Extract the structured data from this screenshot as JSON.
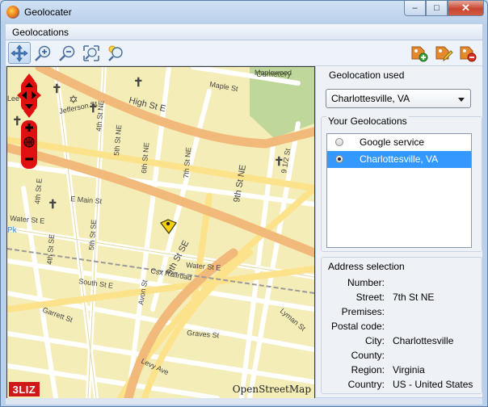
{
  "window": {
    "title": "Geolocater",
    "controls": {
      "minimize": "–",
      "maximize": "□",
      "close": "✕"
    }
  },
  "menubar": {
    "items": [
      "Geolocations"
    ]
  },
  "toolbar": {
    "left_tools": [
      "pan-icon",
      "zoom-in-icon",
      "zoom-out-icon",
      "zoom-extent-icon",
      "zoom-location-icon"
    ],
    "right_tools": [
      "add-location-icon",
      "edit-location-icon",
      "remove-location-icon"
    ],
    "active_tool": "pan-icon"
  },
  "map": {
    "attribution": "OpenStreetMap",
    "brand": "3LIZ",
    "labels": {
      "cemetery1": "Maplewood",
      "cemetery2": "Cemetery",
      "maple": "Maple St",
      "high": "High St E",
      "jefferson": "Jefferson St",
      "fourth_ne": "4th St NE",
      "fifth_ne": "5th St NE",
      "sixth_ne": "6th St NE",
      "seventh_ne": "7th St NE",
      "ninth_ne": "9th St NE",
      "nine_half": "9 1/2 St",
      "fourth_e": "4th St E",
      "emain": "E Main St",
      "water_left": "Water St E",
      "water_right": "Water St E",
      "fourth_se": "4th St SE",
      "ninth_se": "9th St SE",
      "fifth_se": "5th St SE",
      "south": "South St E",
      "csx": "Csx Railroad",
      "avon": "Avon St",
      "garrett": "Garrett St",
      "graves": "Graves St",
      "levy": "Levy Ave",
      "lyman": "Lyman St",
      "leek": "Lee",
      "pk": "Pk"
    }
  },
  "panel": {
    "geolocation_used": {
      "label": "Geolocation used",
      "selected": "Charlottesville, VA"
    },
    "your_geolocations": {
      "label": "Your Geolocations",
      "items": [
        {
          "label": "Google service",
          "selected": false
        },
        {
          "label": "Charlottesville, VA",
          "selected": true
        }
      ]
    },
    "address_selection": {
      "label": "Address selection",
      "fields": [
        {
          "label": "Number:",
          "value": ""
        },
        {
          "label": "Street:",
          "value": "7th St NE"
        },
        {
          "label": "Premises:",
          "value": ""
        },
        {
          "label": "Postal code:",
          "value": ""
        },
        {
          "label": "City:",
          "value": "Charlottesville"
        },
        {
          "label": "County:",
          "value": ""
        },
        {
          "label": "Region:",
          "value": "Virginia"
        },
        {
          "label": "Country:",
          "value": "US - United States"
        }
      ]
    }
  },
  "colors": {
    "map_land": "#f5edb7",
    "major_road": "#f2ba7a",
    "secondary_road": "#fce28b",
    "park": "#bfd79a",
    "selection": "#3399ff",
    "nav_control": "#e01010"
  }
}
